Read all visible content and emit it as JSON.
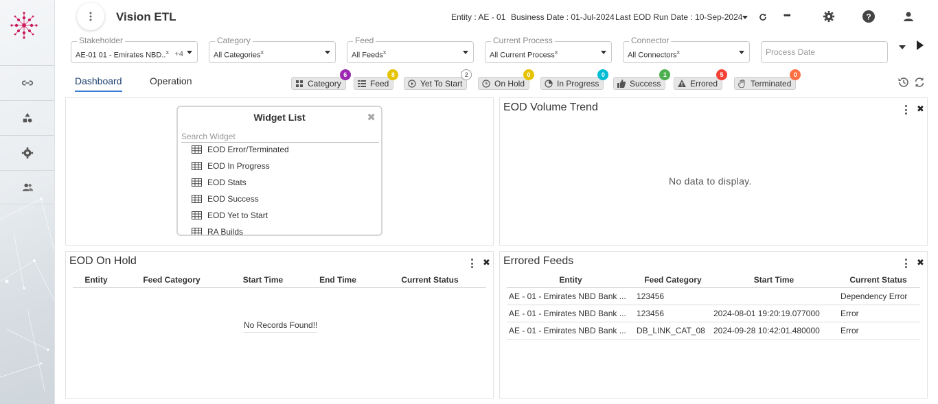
{
  "header": {
    "app_title": "Vision ETL",
    "entity_label": "Entity : ",
    "entity_value": "AE - 01",
    "business_date_label": "Business Date : ",
    "business_date_value": "01-Jul-2024",
    "last_eod_label": "Last EOD Run Date : ",
    "last_eod_value": "10-Sep-2024",
    "more_label": "•••"
  },
  "filters": {
    "stakeholder": {
      "label": "Stakeholder",
      "value": "AE-01 01 - Emirates NBD..",
      "clear": "x",
      "extra": "+4"
    },
    "category": {
      "label": "Category",
      "value": "All Categories",
      "clear": "x"
    },
    "feed": {
      "label": "Feed",
      "value": "All Feeds",
      "clear": "x"
    },
    "current_process": {
      "label": "Current Process",
      "value": "All Current Process",
      "clear": "x"
    },
    "connector": {
      "label": "Connector",
      "value": "All Connectors",
      "clear": "x"
    },
    "process_date": {
      "placeholder": "Process Date"
    }
  },
  "tabs": [
    {
      "label": "Dashboard",
      "active": true
    },
    {
      "label": "Operation",
      "active": false
    }
  ],
  "status_chips": [
    {
      "label": "Category",
      "count": "6",
      "color": "#9c27b0",
      "icon": "grid-icon"
    },
    {
      "label": "Feed",
      "count": "8",
      "color": "#e6c300",
      "icon": "list-icon"
    },
    {
      "label": "Yet To Start",
      "count": "2",
      "color": "#ffffff",
      "icon": "play-circle-icon"
    },
    {
      "label": "On Hold",
      "count": "0",
      "color": "#e6c300",
      "icon": "clock-icon"
    },
    {
      "label": "In Progress",
      "count": "0",
      "color": "#00bcd4",
      "icon": "pie-icon"
    },
    {
      "label": "Success",
      "count": "1",
      "color": "#4caf50",
      "icon": "thumbs-up-icon"
    },
    {
      "label": "Errored",
      "count": "5",
      "color": "#f44336",
      "icon": "warning-icon"
    },
    {
      "label": "Terminated",
      "count": "0",
      "color": "#ff7043",
      "icon": "hand-icon"
    }
  ],
  "widget_list": {
    "title": "Widget List",
    "close": "✖",
    "search_placeholder": "Search Widget",
    "items": [
      "EOD Error/Terminated",
      "EOD In Progress",
      "EOD Stats",
      "EOD Success",
      "EOD Yet to Start",
      "RA Builds"
    ]
  },
  "eod_volume_trend": {
    "title": "EOD Volume Trend",
    "empty_text": "No data to display."
  },
  "eod_on_hold": {
    "title": "EOD On Hold",
    "columns": [
      "Entity",
      "Feed Category",
      "Start Time",
      "End Time",
      "Current Status"
    ],
    "empty_text": "No Records Found!!"
  },
  "errored_feeds": {
    "title": "Errored Feeds",
    "columns": [
      "Entity",
      "Feed Category",
      "Start Time",
      "Current Status"
    ],
    "rows": [
      [
        "AE - 01 - Emirates NBD Bank ...",
        "123456",
        "",
        "Dependency Error"
      ],
      [
        "AE - 01 - Emirates NBD Bank ...",
        "123456",
        "2024-08-01 19:20:19.077000",
        "Error"
      ],
      [
        "AE - 01 - Emirates NBD Bank ...",
        "DB_LINK_CAT_08",
        "2024-09-28 10:42:01.480000",
        "Error"
      ]
    ]
  },
  "panel_close": "✖"
}
